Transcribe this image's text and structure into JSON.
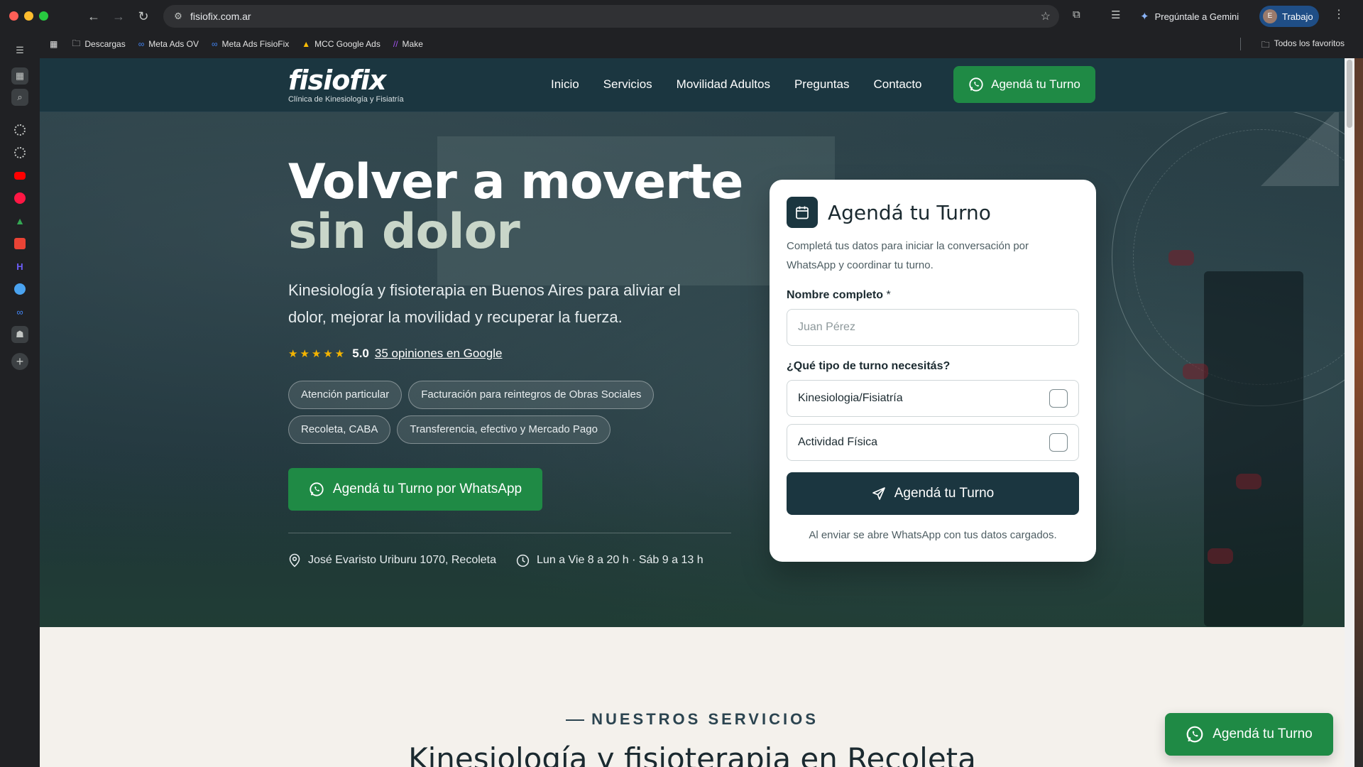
{
  "browser": {
    "url": "fisiofix.com.ar",
    "gemini_label": "Pregúntale a Gemini",
    "profile_label": "Trabajo",
    "profile_initial": "E",
    "bookmarks": [
      "Descargas",
      "Meta Ads OV",
      "Meta Ads FisioFix",
      "MCC Google Ads",
      "Make"
    ],
    "all_bookmarks_label": "Todos los favoritos"
  },
  "site": {
    "logo": {
      "name": "fisiofix",
      "tagline": "Clínica de Kinesiología y Fisiatría"
    },
    "nav": {
      "items": [
        "Inicio",
        "Servicios",
        "Movilidad Adultos",
        "Preguntas",
        "Contacto"
      ],
      "cta": "Agendá tu Turno"
    },
    "hero": {
      "title_line1": "Volver a moverte",
      "title_line2": "sin dolor",
      "lead": "Kinesiología y fisioterapia en Buenos Aires para aliviar el dolor, mejorar la movilidad y recuperar la fuerza.",
      "stars": "★★★★★",
      "score": "5.0",
      "reviews": "35 opiniones en Google",
      "chips": [
        "Atención particular",
        "Facturación para reintegros de Obras Sociales",
        "Recoleta, CABA",
        "Transferencia, efectivo y Mercado Pago"
      ],
      "cta": "Agendá tu Turno por WhatsApp",
      "address": "José Evaristo Uriburu 1070, Recoleta",
      "hours": "Lun a Vie 8 a 20 h · Sáb 9 a 13 h"
    },
    "form": {
      "title": "Agendá tu Turno",
      "subtitle": "Completá tus datos para iniciar la conversación por WhatsApp y coordinar tu turno.",
      "name_label": "Nombre completo",
      "required_mark": "*",
      "name_placeholder": "Juan Pérez",
      "type_label": "¿Qué tipo de turno necesitás?",
      "options": [
        "Kinesiologia/Fisiatría",
        "Actividad Física"
      ],
      "submit": "Agendá tu Turno",
      "note": "Al enviar se abre WhatsApp con tus datos cargados."
    },
    "services": {
      "kicker": "NUESTROS SERVICIOS",
      "title": "Kinesiología y fisioterapia en Recoleta"
    },
    "floating_cta": "Agendá tu Turno"
  },
  "colors": {
    "brand_green": "#1f8a45",
    "brand_dark": "#1b3640",
    "star": "#f4b400"
  }
}
